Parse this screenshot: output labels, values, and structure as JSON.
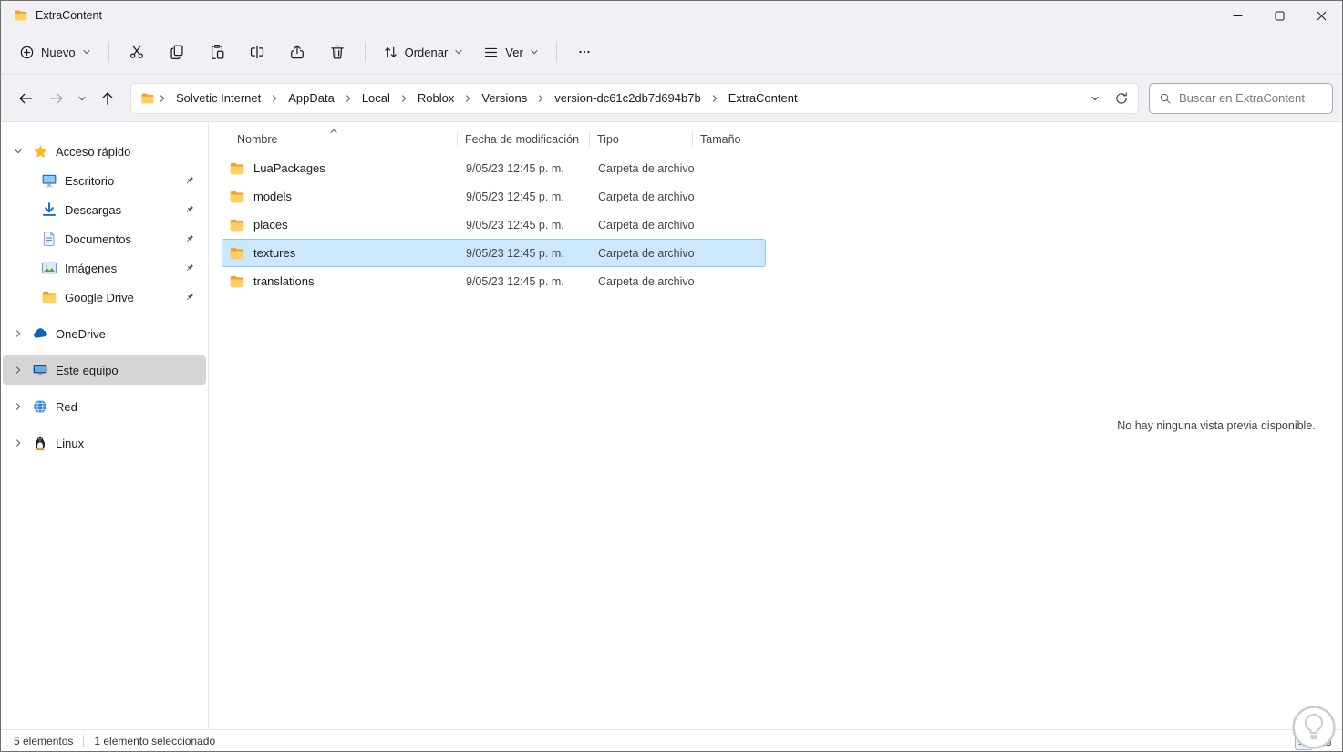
{
  "window": {
    "title": "ExtraContent"
  },
  "toolbar": {
    "new_label": "Nuevo",
    "sort_label": "Ordenar",
    "view_label": "Ver"
  },
  "navbar": {
    "breadcrumbs": [
      "Solvetic Internet",
      "AppData",
      "Local",
      "Roblox",
      "Versions",
      "version-dc61c2db7d694b7b",
      "ExtraContent"
    ],
    "search_placeholder": "Buscar en ExtraContent"
  },
  "sidebar": {
    "quick_access_label": "Acceso rápido",
    "quick_access_items": [
      "Escritorio",
      "Descargas",
      "Documentos",
      "Imágenes",
      "Google Drive"
    ],
    "onedrive_label": "OneDrive",
    "this_pc_label": "Este equipo",
    "network_label": "Red",
    "linux_label": "Linux"
  },
  "files": {
    "columns": {
      "name": "Nombre",
      "modified": "Fecha de modificación",
      "type": "Tipo",
      "size": "Tamaño"
    },
    "rows": [
      {
        "name": "LuaPackages",
        "modified": "9/05/23 12:45 p. m.",
        "type": "Carpeta de archivos",
        "size": ""
      },
      {
        "name": "models",
        "modified": "9/05/23 12:45 p. m.",
        "type": "Carpeta de archivos",
        "size": ""
      },
      {
        "name": "places",
        "modified": "9/05/23 12:45 p. m.",
        "type": "Carpeta de archivos",
        "size": ""
      },
      {
        "name": "textures",
        "modified": "9/05/23 12:45 p. m.",
        "type": "Carpeta de archivos",
        "size": ""
      },
      {
        "name": "translations",
        "modified": "9/05/23 12:45 p. m.",
        "type": "Carpeta de archivos",
        "size": ""
      }
    ],
    "selected": "textures",
    "sort_column": "Nombre",
    "sort_direction": "ascending"
  },
  "preview": {
    "empty_message": "No hay ninguna vista previa disponible."
  },
  "statusbar": {
    "items_count": "5 elementos",
    "selection_count": "1 elemento seleccionado"
  },
  "colors": {
    "selection_bg": "#cce8ff",
    "selection_border": "#8ec7f5",
    "sidebar_selected_bg": "#d5d5d5",
    "chrome_bg": "#f0f1f4",
    "folder_icon": "#f5a623"
  },
  "icons": {
    "window": "folder",
    "new": "plus-circle",
    "cut": "scissors",
    "copy": "two-pages",
    "paste": "clipboard",
    "rename": "text-cursor-box",
    "share": "arrow-out-of-box",
    "delete": "trash-can",
    "sort": "up-down-arrows",
    "view": "list-lines",
    "more": "ellipsis",
    "back": "arrow-left",
    "forward": "arrow-right",
    "up": "arrow-up",
    "refresh": "circular-arrow",
    "search": "magnifier",
    "quick_access": "star",
    "desktop": "monitor",
    "downloads": "down-arrow",
    "documents": "document",
    "pictures": "picture",
    "google_drive": "folder",
    "onedrive": "cloud",
    "this_pc": "computer",
    "network": "globe",
    "linux": "penguin",
    "watermark": "lightbulb-circle"
  }
}
